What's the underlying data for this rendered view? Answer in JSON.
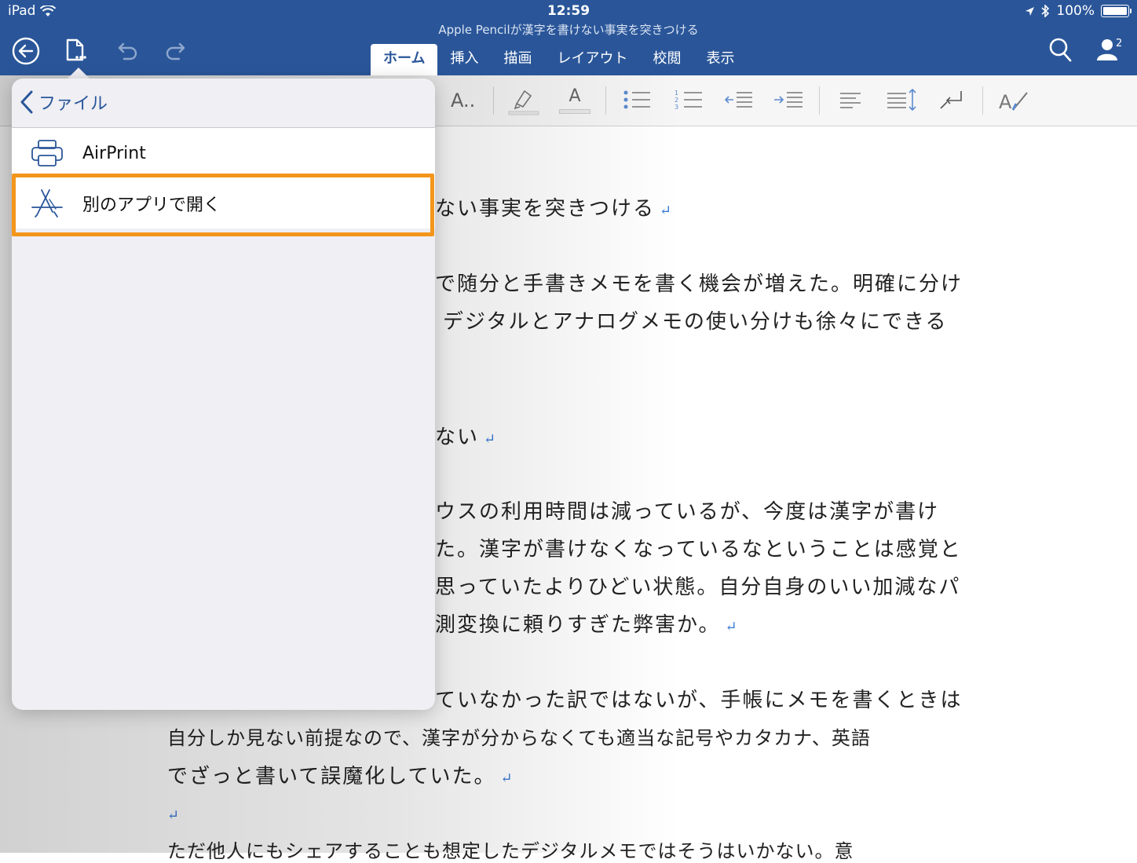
{
  "status_bar": {
    "device": "iPad",
    "time": "12:59",
    "battery": "100%"
  },
  "document_title": "Apple Pencilが漢字を書けない事実を突きつける",
  "tabs": [
    {
      "label": "ホーム",
      "active": true
    },
    {
      "label": "挿入"
    },
    {
      "label": "描画"
    },
    {
      "label": "レイアウト"
    },
    {
      "label": "校閲"
    },
    {
      "label": "表示"
    }
  ],
  "account_badge": "2",
  "ribbon": {
    "font_style_label": "A..",
    "font_color_label": "A"
  },
  "popover": {
    "back_label": "ファイル",
    "items": [
      {
        "label": "AirPrint",
        "icon": "printer-icon"
      },
      {
        "label": "別のアプリで開く",
        "icon": "app-store-icon",
        "highlighted": true
      }
    ],
    "highlight_color": "#f3961b"
  },
  "document": {
    "paragraphs": [
      "ない事実を突きつける",
      "で随分と手書きメモを書く機会が増えた。明確に分け",
      "デジタルとアナログメモの使い分けも徐々にできる",
      "ない",
      "ウスの利用時間は減っているが、今度は漢字が書け",
      "た。漢字が書けなくなっているなということは感覚と",
      "思っていたよりひどい状態。自分自身のいい加減なパ",
      "測変換に頼りすぎた弊害か。",
      "ていなかった訳ではないが、手帳にメモを書くときは",
      "自分しか見ない前提なので、漢字が分からなくても適当な記号やカタカナ、英語",
      "でざっと書いて誤魔化していた。",
      "ただ他人にもシェアすることも想定したデジタルメモではそうはいかない。意"
    ],
    "paragraph_mark": "↵"
  },
  "colors": {
    "title_bar": "#2a5699",
    "accent": "#2a5699",
    "highlight": "#f3961b"
  }
}
